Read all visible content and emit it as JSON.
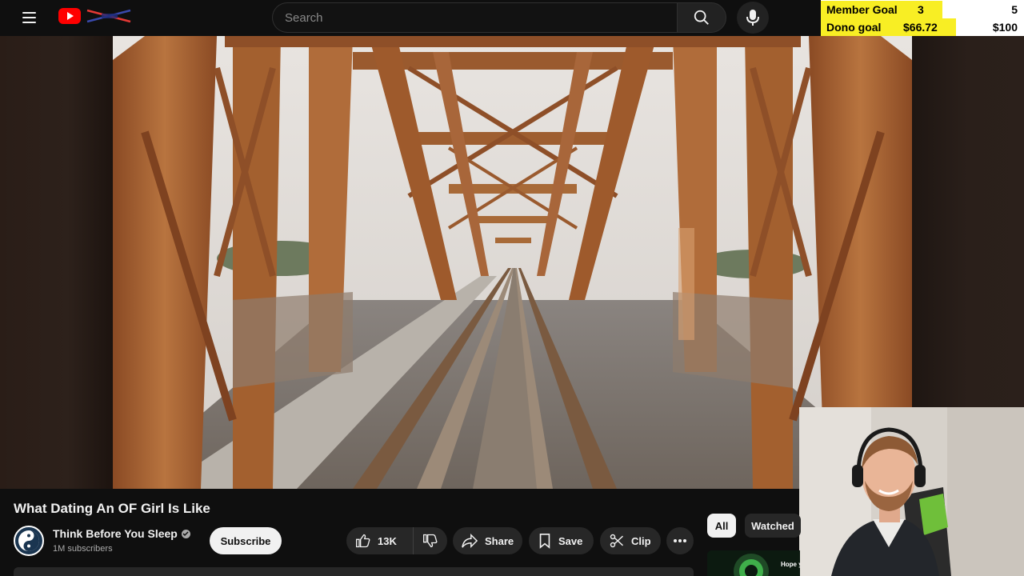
{
  "header": {
    "search_placeholder": "Search",
    "icons": [
      "menu-icon",
      "youtube-logo",
      "search-icon",
      "microphone-icon"
    ]
  },
  "stream_goals": [
    {
      "label": "Member Goal",
      "current": "3",
      "target": "5",
      "progress": 0.6
    },
    {
      "label": "Dono goal",
      "current": "$66.72",
      "target": "$100",
      "progress": 0.667
    }
  ],
  "video": {
    "title": "What Dating An OF Girl Is Like",
    "channel": "Think Before You Sleep",
    "subscribers": "1M subscribers",
    "subscribe_label": "Subscribe",
    "likes": "13K",
    "share_label": "Share",
    "save_label": "Save",
    "clip_label": "Clip"
  },
  "sidebar_chips": {
    "all": "All",
    "watched": "Watched"
  },
  "thumbnail_peek_text": "Hope y",
  "colors": {
    "background": "#0f0f0f",
    "accent_red": "#ff0000",
    "goal_yellow": "#f8ee24",
    "pill": "#272727"
  }
}
